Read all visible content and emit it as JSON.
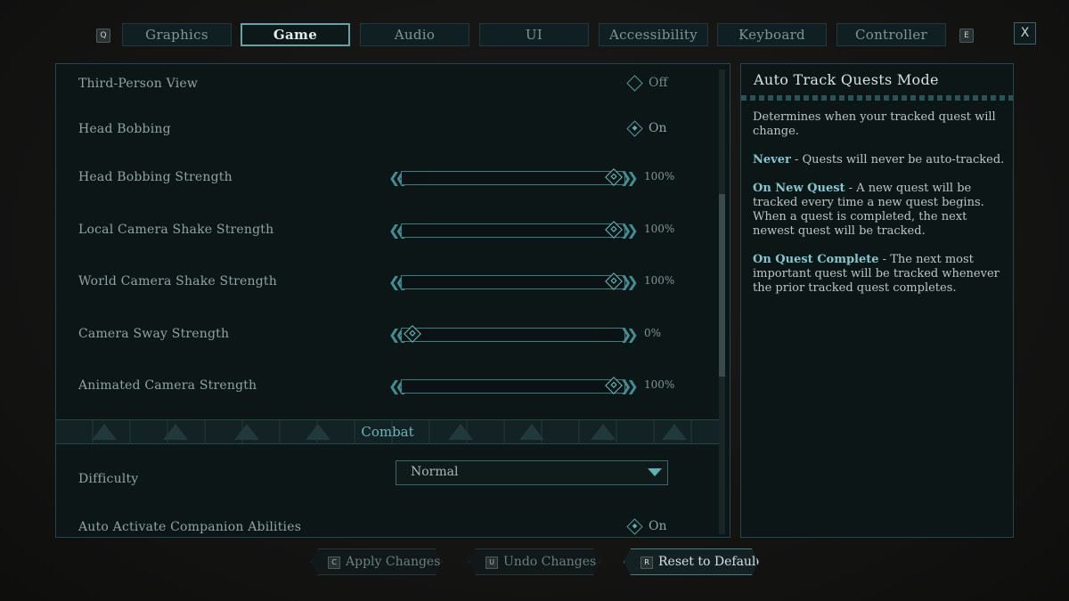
{
  "tabs": {
    "prev_key": "Q",
    "next_key": "E",
    "items": [
      {
        "label": "Graphics"
      },
      {
        "label": "Game"
      },
      {
        "label": "Audio"
      },
      {
        "label": "UI"
      },
      {
        "label": "Accessibility"
      },
      {
        "label": "Keyboard"
      },
      {
        "label": "Controller"
      }
    ],
    "active": "Game",
    "close_label": "X"
  },
  "settings": {
    "third_person": {
      "label": "Third-Person View",
      "value": "Off"
    },
    "head_bobbing": {
      "label": "Head Bobbing",
      "value": "On"
    },
    "sliders": [
      {
        "label": "Head Bobbing Strength",
        "value": "100%",
        "fraction": 1.0
      },
      {
        "label": "Local Camera Shake Strength",
        "value": "100%",
        "fraction": 1.0
      },
      {
        "label": "World Camera Shake Strength",
        "value": "100%",
        "fraction": 1.0
      },
      {
        "label": "Camera Sway Strength",
        "value": "0%",
        "fraction": 0.0
      },
      {
        "label": "Animated Camera Strength",
        "value": "100%",
        "fraction": 1.0
      }
    ],
    "combat_section": "Combat",
    "difficulty": {
      "label": "Difficulty",
      "value": "Normal"
    },
    "companion": {
      "label": "Auto Activate Companion Abilities",
      "value": "On"
    }
  },
  "info": {
    "title": "Auto Track Quests Mode",
    "intro": "Determines when your tracked quest will change.",
    "never_term": "Never",
    "never_desc": " - Quests will never be auto-tracked.",
    "new_term": "On New Quest",
    "new_desc": " - A new quest will be tracked every time a new quest begins. When a quest is completed, the next newest quest will be tracked.",
    "complete_term": "On Quest Complete",
    "complete_desc": " - The next most important quest will be tracked whenever the prior tracked quest completes."
  },
  "footer": {
    "apply": {
      "key": "C",
      "label": "Apply Changes"
    },
    "undo": {
      "key": "U",
      "label": "Undo Changes"
    },
    "reset": {
      "key": "R",
      "label": "Reset to Default"
    }
  },
  "colors": {
    "accent": "#5fb0b1",
    "panel_bg": "#0d1617",
    "border": "#24474a"
  }
}
